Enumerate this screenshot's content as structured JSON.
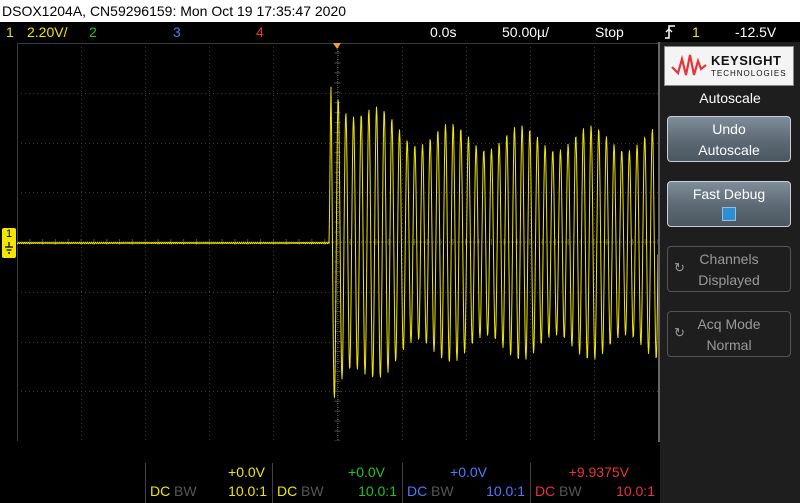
{
  "title_bar": "DSOX1204A, CN59296159: Mon Oct 19 17:35:47 2020",
  "status": {
    "ch1_num": "1",
    "ch1_scale": "2.20V/",
    "ch2_num": "2",
    "ch3_num": "3",
    "ch4_num": "4",
    "time_delay": "0.0s",
    "time_scale": "50.00µ/",
    "run_state": "Stop",
    "trigger_source": "1",
    "trigger_level": "-12.5V"
  },
  "colors": {
    "ch1": "#f2e600",
    "ch2": "#22c322",
    "ch3": "#4a7cff",
    "ch4": "#e8333a",
    "trigger": "#f0a030"
  },
  "softkeys": {
    "menu_title": "Autoscale",
    "undo_line1": "Undo",
    "undo_line2": "Autoscale",
    "fast_debug": "Fast Debug",
    "channels_line1": "Channels",
    "channels_line2": "Displayed",
    "acq_line1": "Acq Mode",
    "acq_line2": "Normal"
  },
  "brand": {
    "name": "KEYSIGHT",
    "sub": "TECHNOLOGIES"
  },
  "channels": [
    {
      "offset": "+0.0V",
      "coupling": "DC",
      "bw": "BW",
      "probe": "10.0:1"
    },
    {
      "offset": "+0.0V",
      "coupling": "DC",
      "bw": "BW",
      "probe": "10.0:1"
    },
    {
      "offset": "+0.0V",
      "coupling": "DC",
      "bw": "BW",
      "probe": "10.0:1"
    },
    {
      "offset": "+9.9375V",
      "coupling": "DC",
      "bw": "BW",
      "probe": "10.0:1"
    }
  ],
  "ground_marker": "1",
  "icons": {
    "trigger": "rising-edge-icon",
    "refresh": "refresh-icon",
    "logo": "keysight-wave-icon"
  }
}
